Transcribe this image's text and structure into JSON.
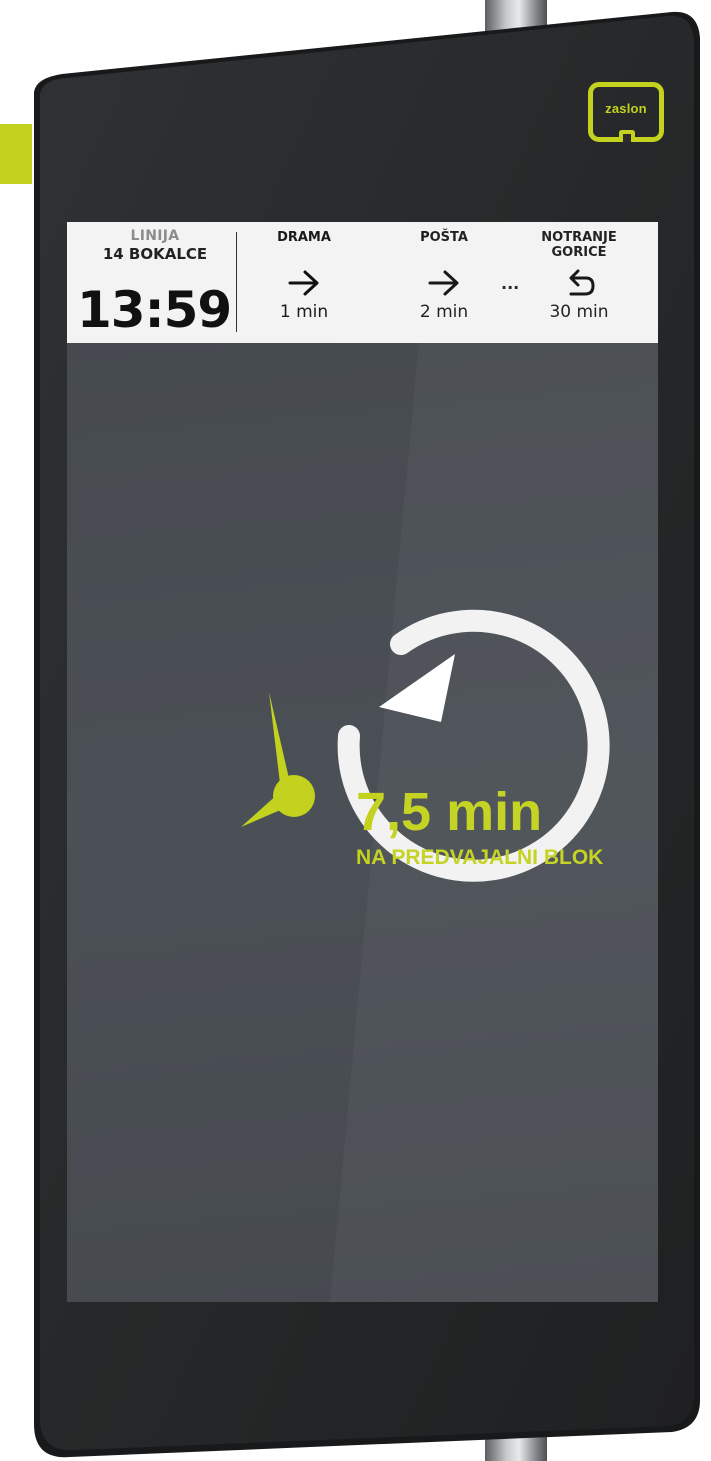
{
  "brand": {
    "logo_text": "zaslon",
    "accent_color": "#c3d21e"
  },
  "header": {
    "route_label": "LINIJA",
    "route_name": "14 BOKALCE",
    "current_time": "13:59",
    "stops": [
      {
        "name": "DRAMA",
        "direction_icon": "arrow-right-icon",
        "eta": "1 min"
      },
      {
        "name": "POŠTA",
        "direction_icon": "arrow-right-icon",
        "eta": "2 min"
      },
      {
        "name": "NOTRANJE GORICE",
        "direction_icon": "turnaround-arrow-icon",
        "eta": "30 min"
      }
    ],
    "more_stops": "..."
  },
  "main": {
    "icon": "clock-cycle-icon",
    "wait_value": "7,5 min",
    "wait_caption": "NA PREDVAJALNI BLOK"
  }
}
